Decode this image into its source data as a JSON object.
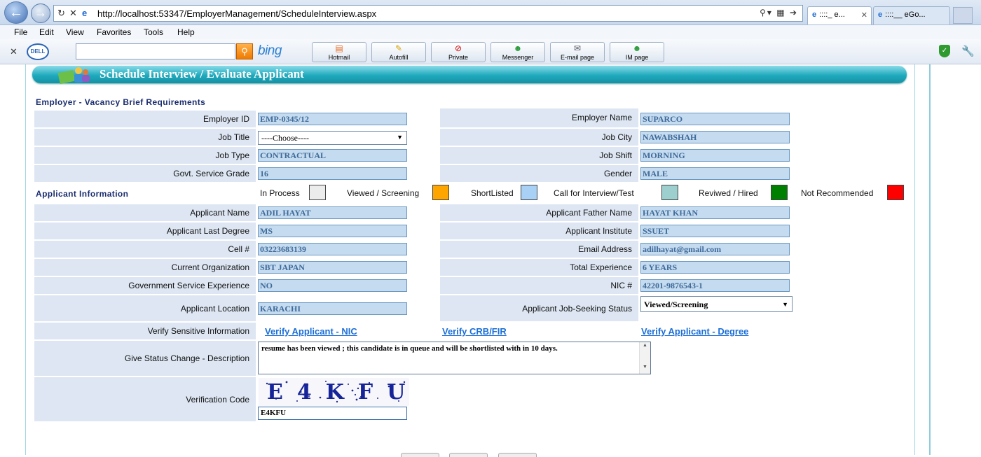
{
  "browser": {
    "url": "http://localhost:53347/EmployerManagement/ScheduleInterview.aspx",
    "tabs": [
      {
        "label": "::::_ e..."
      },
      {
        "label": "::::__ eGo..."
      }
    ],
    "menu": [
      "File",
      "Edit",
      "View",
      "Favorites",
      "Tools",
      "Help"
    ],
    "search_brand": "bing",
    "dell_brand": "DELL",
    "toolbar_buttons": [
      "Hotmail",
      "Autofill",
      "Private",
      "Messenger",
      "E-mail page",
      "IM page"
    ]
  },
  "page": {
    "title": "Schedule Interview / Evaluate Applicant",
    "section_employer": "Employer - Vacancy Brief Requirements",
    "section_applicant": "Applicant Information"
  },
  "employer": {
    "employer_id_label": "Employer ID",
    "employer_id": "EMP-0345/12",
    "employer_name_label": "Employer Name",
    "employer_name": "SUPARCO",
    "job_title_label": "Job Title",
    "job_title": "----Choose----",
    "job_city_label": "Job City",
    "job_city": "NAWABSHAH",
    "job_type_label": "Job Type",
    "job_type": "CONTRACTUAL",
    "job_shift_label": "Job Shift",
    "job_shift": "MORNING",
    "grade_label": "Govt. Service Grade",
    "grade": "16",
    "gender_label": "Gender",
    "gender": "MALE"
  },
  "legend": [
    {
      "label": "In Process",
      "color": "#ececec"
    },
    {
      "label": "Viewed / Screening",
      "color": "#ffa500"
    },
    {
      "label": "ShortListed",
      "color": "#a9d0f5"
    },
    {
      "label": "Call for Interview/Test",
      "color": "#9ecfcf"
    },
    {
      "label": "Reviwed / Hired",
      "color": "#008000"
    },
    {
      "label": "Not Recommended",
      "color": "#ff0000"
    }
  ],
  "applicant": {
    "name_label": "Applicant Name",
    "name": "ADIL HAYAT",
    "father_label": "Applicant Father Name",
    "father": "HAYAT KHAN",
    "degree_label": "Applicant Last Degree",
    "degree": "MS",
    "institute_label": "Applicant Institute",
    "institute": "SSUET",
    "cell_label": "Cell #",
    "cell": "03223683139",
    "email_label": "Email Address",
    "email": "adilhayat@gmail.com",
    "org_label": "Current Organization",
    "org": "SBT JAPAN",
    "experience_label": "Total Experience",
    "experience": "6 YEARS",
    "gov_exp_label": "Government Service Experience",
    "gov_exp": "NO",
    "nic_label": "NIC #",
    "nic": "42201-9876543-1",
    "location_label": "Applicant Location",
    "location": "KARACHI",
    "status_label": "Applicant Job-Seeking Status",
    "status": "Viewed/Screening"
  },
  "verify": {
    "label": "Verify Sensitive Information",
    "links": [
      "Verify Applicant - NIC",
      "Verify CRB/FIR",
      "Verify Applicant - Degree"
    ]
  },
  "description": {
    "label": "Give Status Change - Description",
    "text": "resume has been viewed ; this candidate is in queue and will be shortlisted with in 10 days."
  },
  "verification": {
    "label": "Verification Code",
    "captcha_text": "E4KFU",
    "input_value": "E4KFU"
  }
}
